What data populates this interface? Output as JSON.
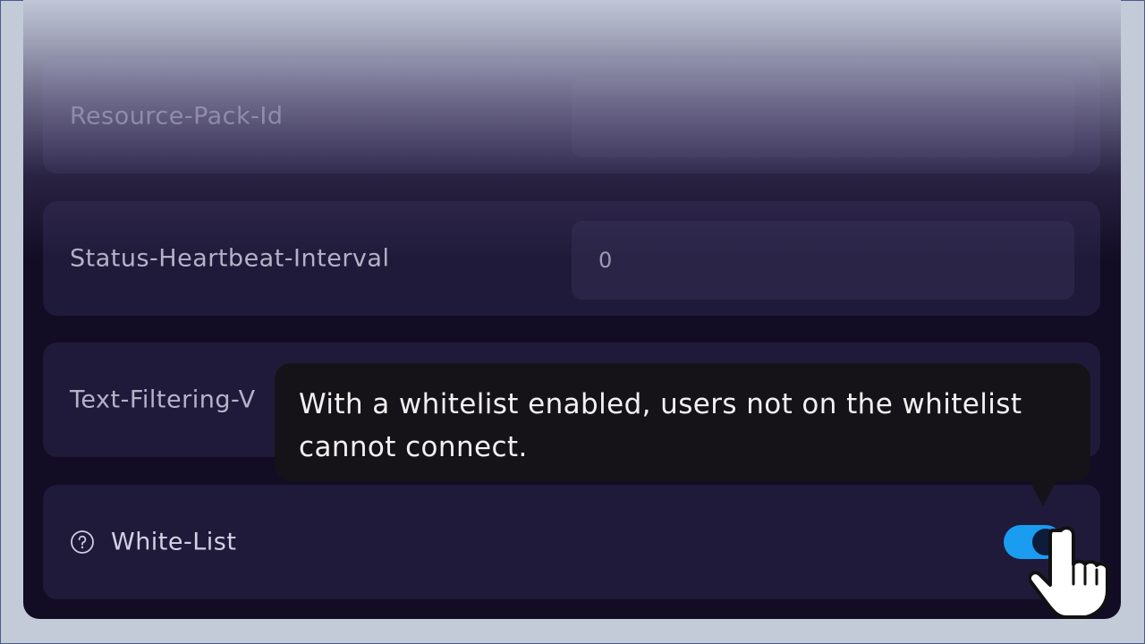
{
  "settings": {
    "rows": [
      {
        "label": "Resource-Pack-Id",
        "value": ""
      },
      {
        "label": "Status-Heartbeat-Interval",
        "value": "0"
      },
      {
        "label": "Text-Filtering-V"
      },
      {
        "label": "White-List",
        "enabled": true
      }
    ]
  },
  "tooltip": {
    "text_line1": "With a whitelist enabled, users not on the whitelist",
    "text_line2": "cannot connect."
  },
  "icons": {
    "help": "help-circle-icon",
    "cursor": "hand-pointer-icon"
  },
  "colors": {
    "panel_bg": "#120d24",
    "row_bg": "#201a3a",
    "input_bg": "#2a2446",
    "toggle_on": "#1a9cf0",
    "tooltip_bg": "#151318"
  }
}
